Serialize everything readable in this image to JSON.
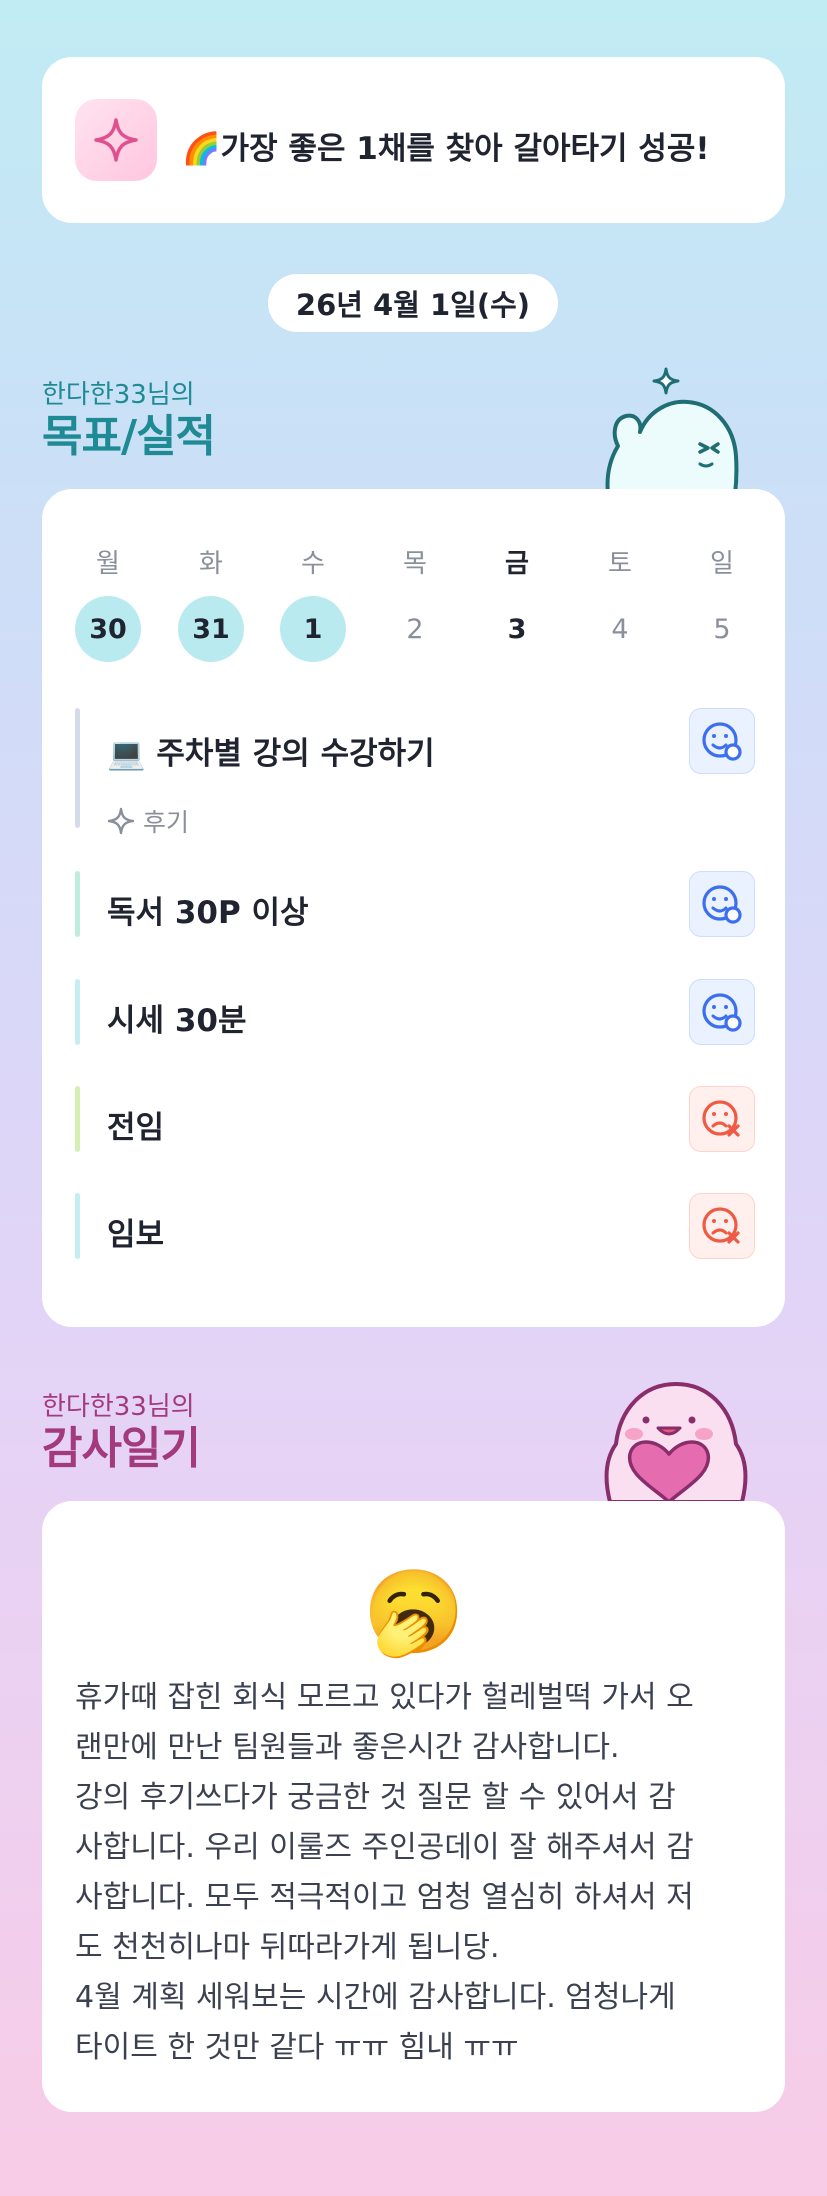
{
  "banner": {
    "icon": "sparkle-icon",
    "text": "🌈가장 좋은 1채를 찾아 갈아타기 성공!"
  },
  "date": "26년 4월 1일(수)",
  "goals_section": {
    "subtitle": "한다한33님의",
    "title": "목표/실적"
  },
  "week": {
    "days": [
      {
        "label": "월",
        "date": "30",
        "state": "done"
      },
      {
        "label": "화",
        "date": "31",
        "state": "done"
      },
      {
        "label": "수",
        "date": "1",
        "state": "done"
      },
      {
        "label": "목",
        "date": "2",
        "state": "none"
      },
      {
        "label": "금",
        "date": "3",
        "state": "today"
      },
      {
        "label": "토",
        "date": "4",
        "state": "none"
      },
      {
        "label": "일",
        "date": "5",
        "state": "none"
      }
    ]
  },
  "goals": [
    {
      "label": "💻 주차별 강의 수강하기",
      "review_label": "후기",
      "status": "success",
      "bar_color": "#d5dbe8"
    },
    {
      "label": "독서 30P 이상",
      "status": "success",
      "bar_color": "#bdeedd"
    },
    {
      "label": "시세 30분",
      "status": "success",
      "bar_color": "#c5eef0"
    },
    {
      "label": "전임",
      "status": "fail",
      "bar_color": "#d6f0b4"
    },
    {
      "label": "임보",
      "status": "fail",
      "bar_color": "#c5eef0"
    }
  ],
  "thanks_section": {
    "subtitle": "한다한33님의",
    "title": "감사일기"
  },
  "diary": {
    "emoji": "🥱",
    "text": "휴가때 잡힌 회식 모르고 있다가 헐레벌떡 가서 오\n랜만에 만난 팀원들과 좋은시간 감사합니다.\n강의 후기쓰다가 궁금한 것 질문 할 수 있어서 감\n사합니다. 우리 이룰즈 주인공데이 잘 해주셔서 감\n사합니다. 모두 적극적이고 엄청 열심히 하셔서 저\n도 천천히나마 뒤따라가게 됩니당.\n4월 계획 세워보는 시간에 감사합니다. 엄청나게\n타이트 한 것만 같다 ㅠㅠ 힘내 ㅠㅠ"
  },
  "colors": {
    "goals_title": "#1e8a93",
    "thanks_title": "#a23a7d",
    "success": "#3b6ff0",
    "fail": "#ef5a44"
  }
}
